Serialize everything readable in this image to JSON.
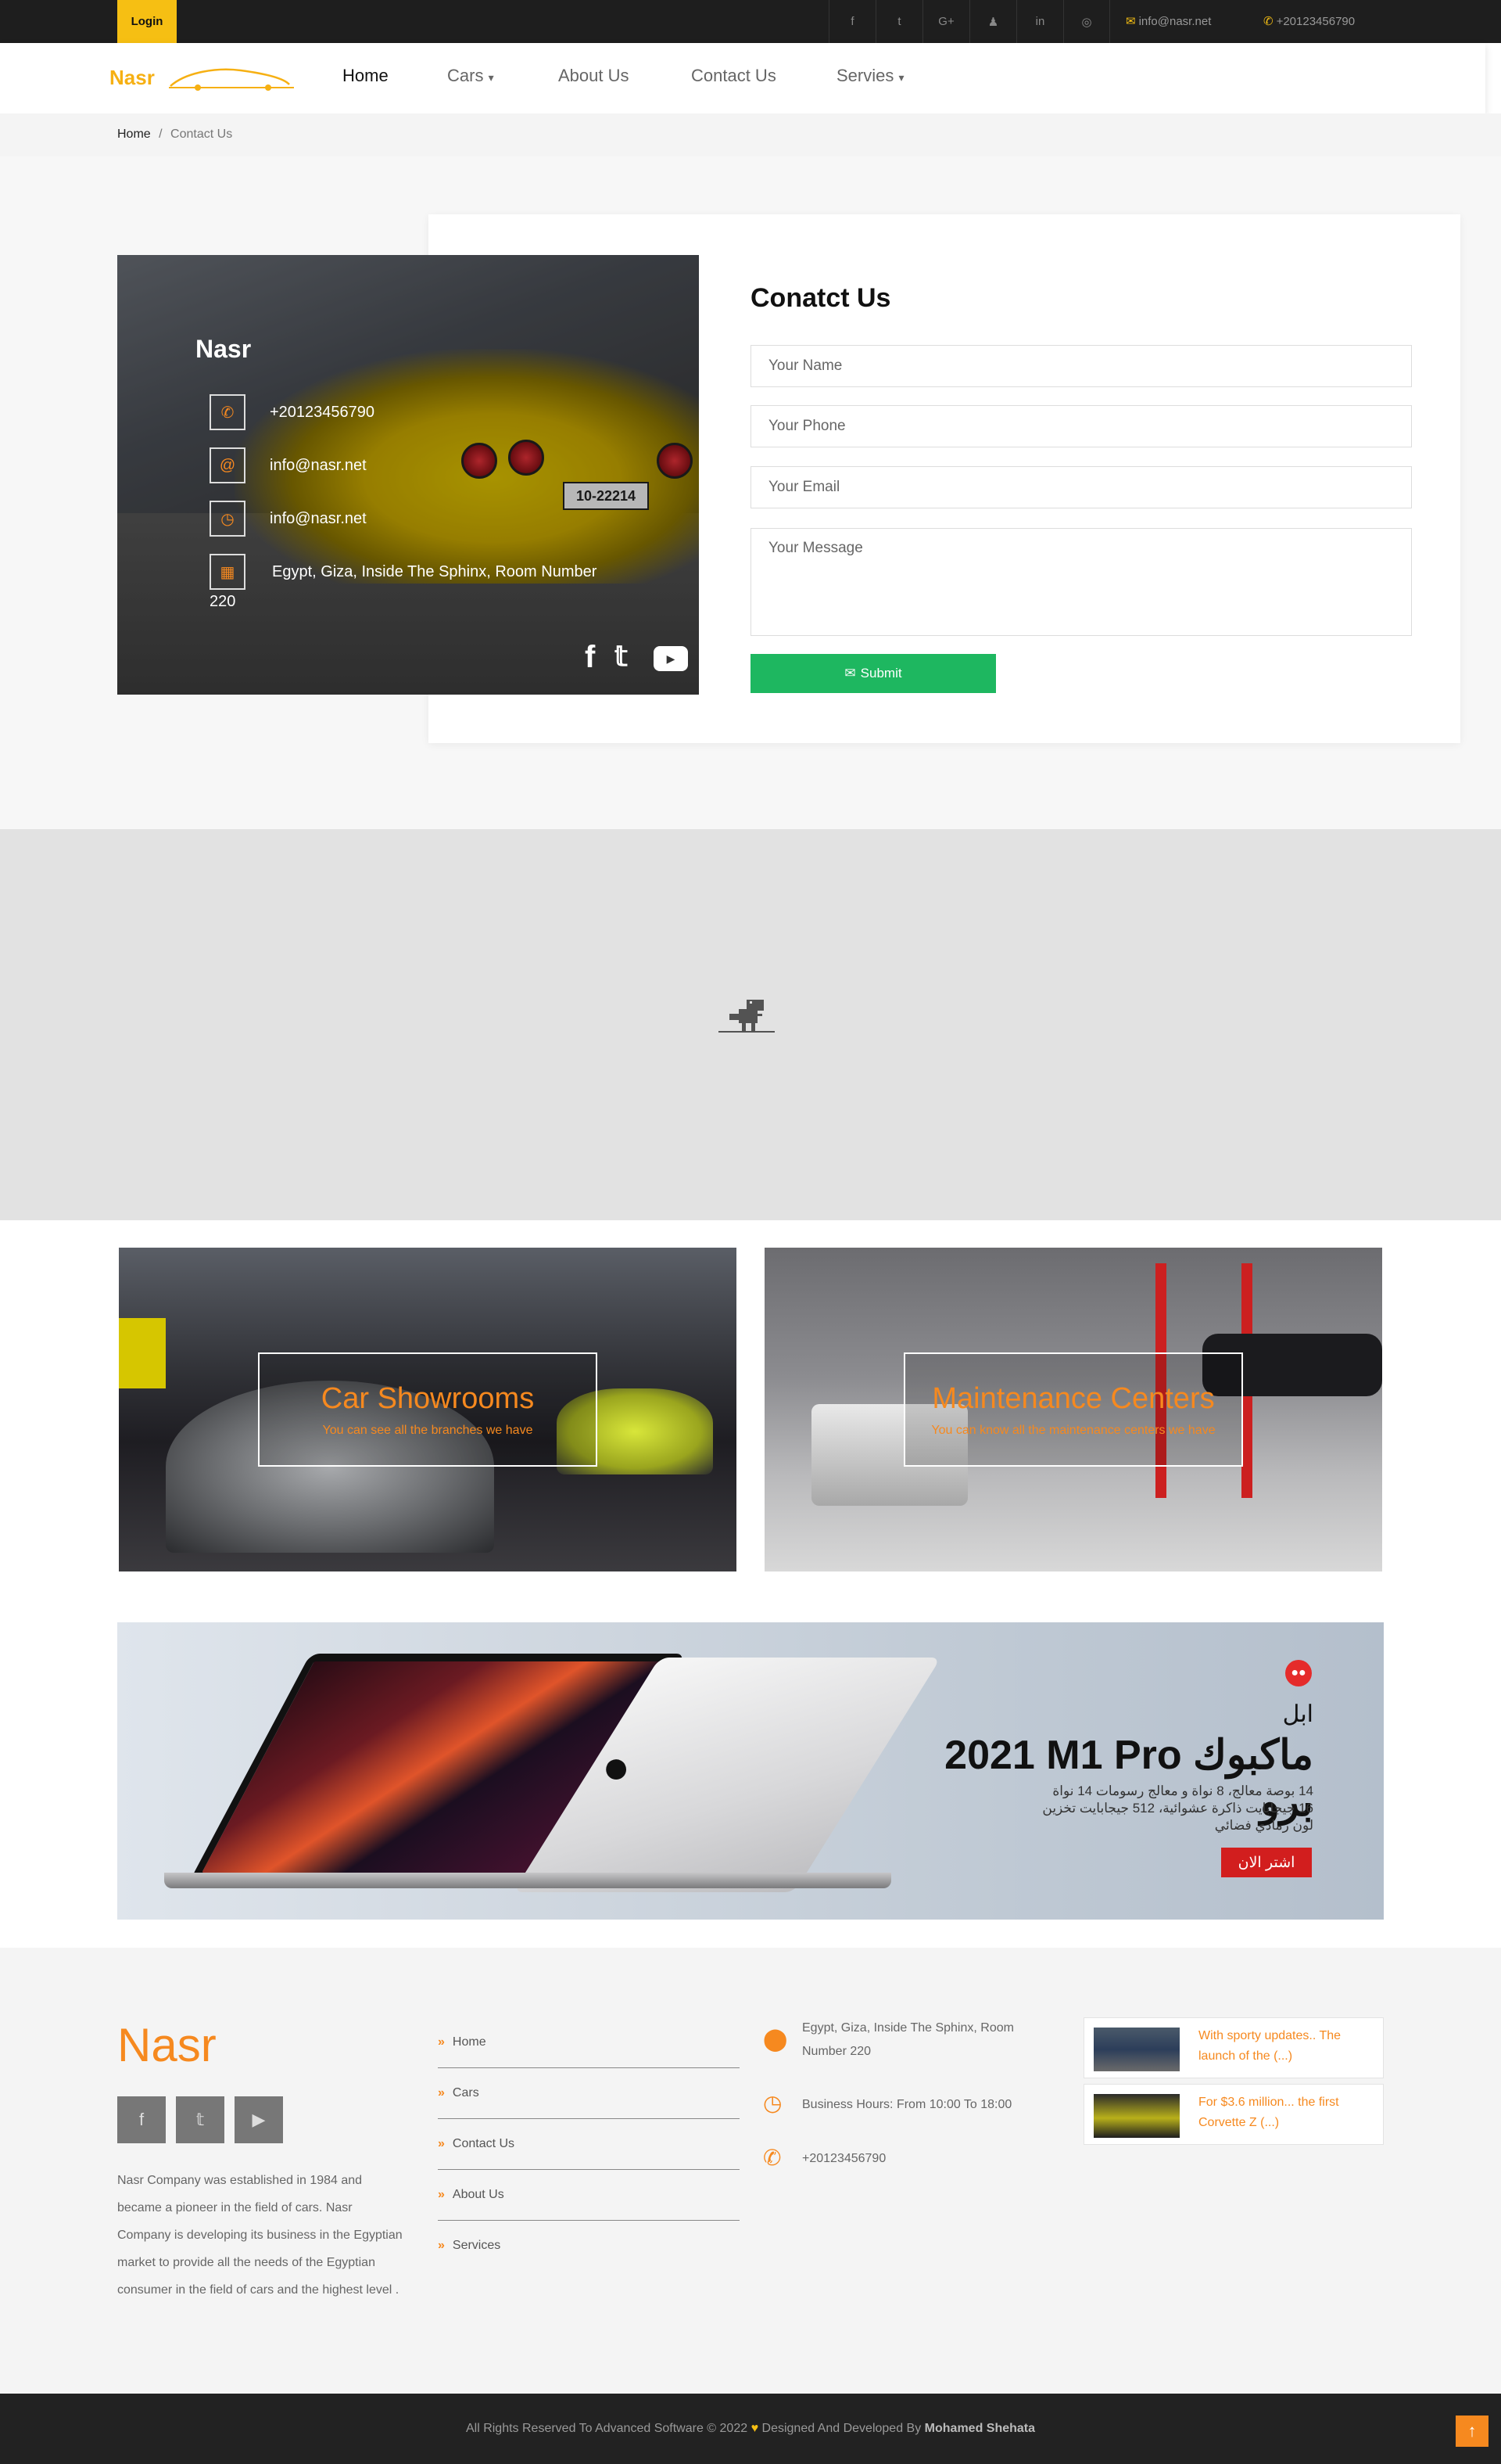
{
  "topbar": {
    "login_label": "Login",
    "socials": [
      "f",
      "t",
      "G+",
      "♟",
      "in",
      "◎"
    ],
    "email": "info@nasr.net",
    "phone": "+20123456790"
  },
  "nav": {
    "logo_text": "Nasr",
    "items": [
      {
        "label": "Home",
        "active": true
      },
      {
        "label": "Cars",
        "dropdown": true
      },
      {
        "label": "About Us",
        "dropdown": false
      },
      {
        "label": "Contact Us",
        "dropdown": false
      },
      {
        "label": "Servies",
        "dropdown": true
      }
    ]
  },
  "breadcrumb": {
    "home": "Home",
    "separator": "/",
    "current": "Contact Us"
  },
  "info_panel": {
    "title": "Nasr",
    "plate": "10-22214",
    "phone": "+20123456790",
    "email": "info@nasr.net",
    "email2": "info@nasr.net",
    "address_line1": "Egypt, Giza, Inside The Sphinx, Room Number",
    "address_line2": "220",
    "icons": [
      "phone-icon",
      "at-icon",
      "clock-icon",
      "building-icon"
    ]
  },
  "form": {
    "title": "Conatct Us",
    "name_placeholder": "Your Name",
    "phone_placeholder": "Your Phone",
    "email_placeholder": "Your Email",
    "message_placeholder": "Your Message",
    "submit_label": "Submit"
  },
  "promos": [
    {
      "title": "Car Showrooms",
      "subtitle": "You can see all the branches we have"
    },
    {
      "title": "Maintenance Centers",
      "subtitle": "You can know all the maintenance centers we have"
    }
  ],
  "banner": {
    "brand": "ابل",
    "title": "2021 M1 Pro ماكبوك برو",
    "line1": "14 بوصة معالج، 8 نواة و معالج رسومات 14 نواة",
    "line2": "16 جيجابايت ذاكرة عشوائية، 512 جيجابايت تخزين",
    "line3": "لون رمادي فضائي",
    "cta": "اشتر الان"
  },
  "footer": {
    "logo_text": "Nasr",
    "description": "Nasr Company was established in 1984 and became a pioneer in the field of cars. Nasr Company is developing its business in the Egyptian market to provide all the needs of the Egyptian consumer in the field of cars and the highest level .",
    "links": [
      "Home",
      "Cars",
      "Contact Us",
      "About Us",
      "Services"
    ],
    "address": "Egypt, Giza, Inside The Sphinx, Room Number 220",
    "hours": "Business Hours: From 10:00 To 18:00",
    "phone": "+20123456790",
    "news": [
      {
        "text": "With sporty updates.. The launch of the (...)"
      },
      {
        "text": "For $3.6 million... the first Corvette Z (...)"
      }
    ]
  },
  "bottom": {
    "copyright_prefix": "All Rights Reserved To Advanced Software © 2022",
    "copyright_mid": "Designed And Developed By",
    "author": "Mohamed Shehata"
  },
  "colors": {
    "accent_yellow": "#f6bf13",
    "accent_orange": "#f6891f",
    "submit_green": "#1eb760",
    "cta_red": "#d21e1e"
  }
}
